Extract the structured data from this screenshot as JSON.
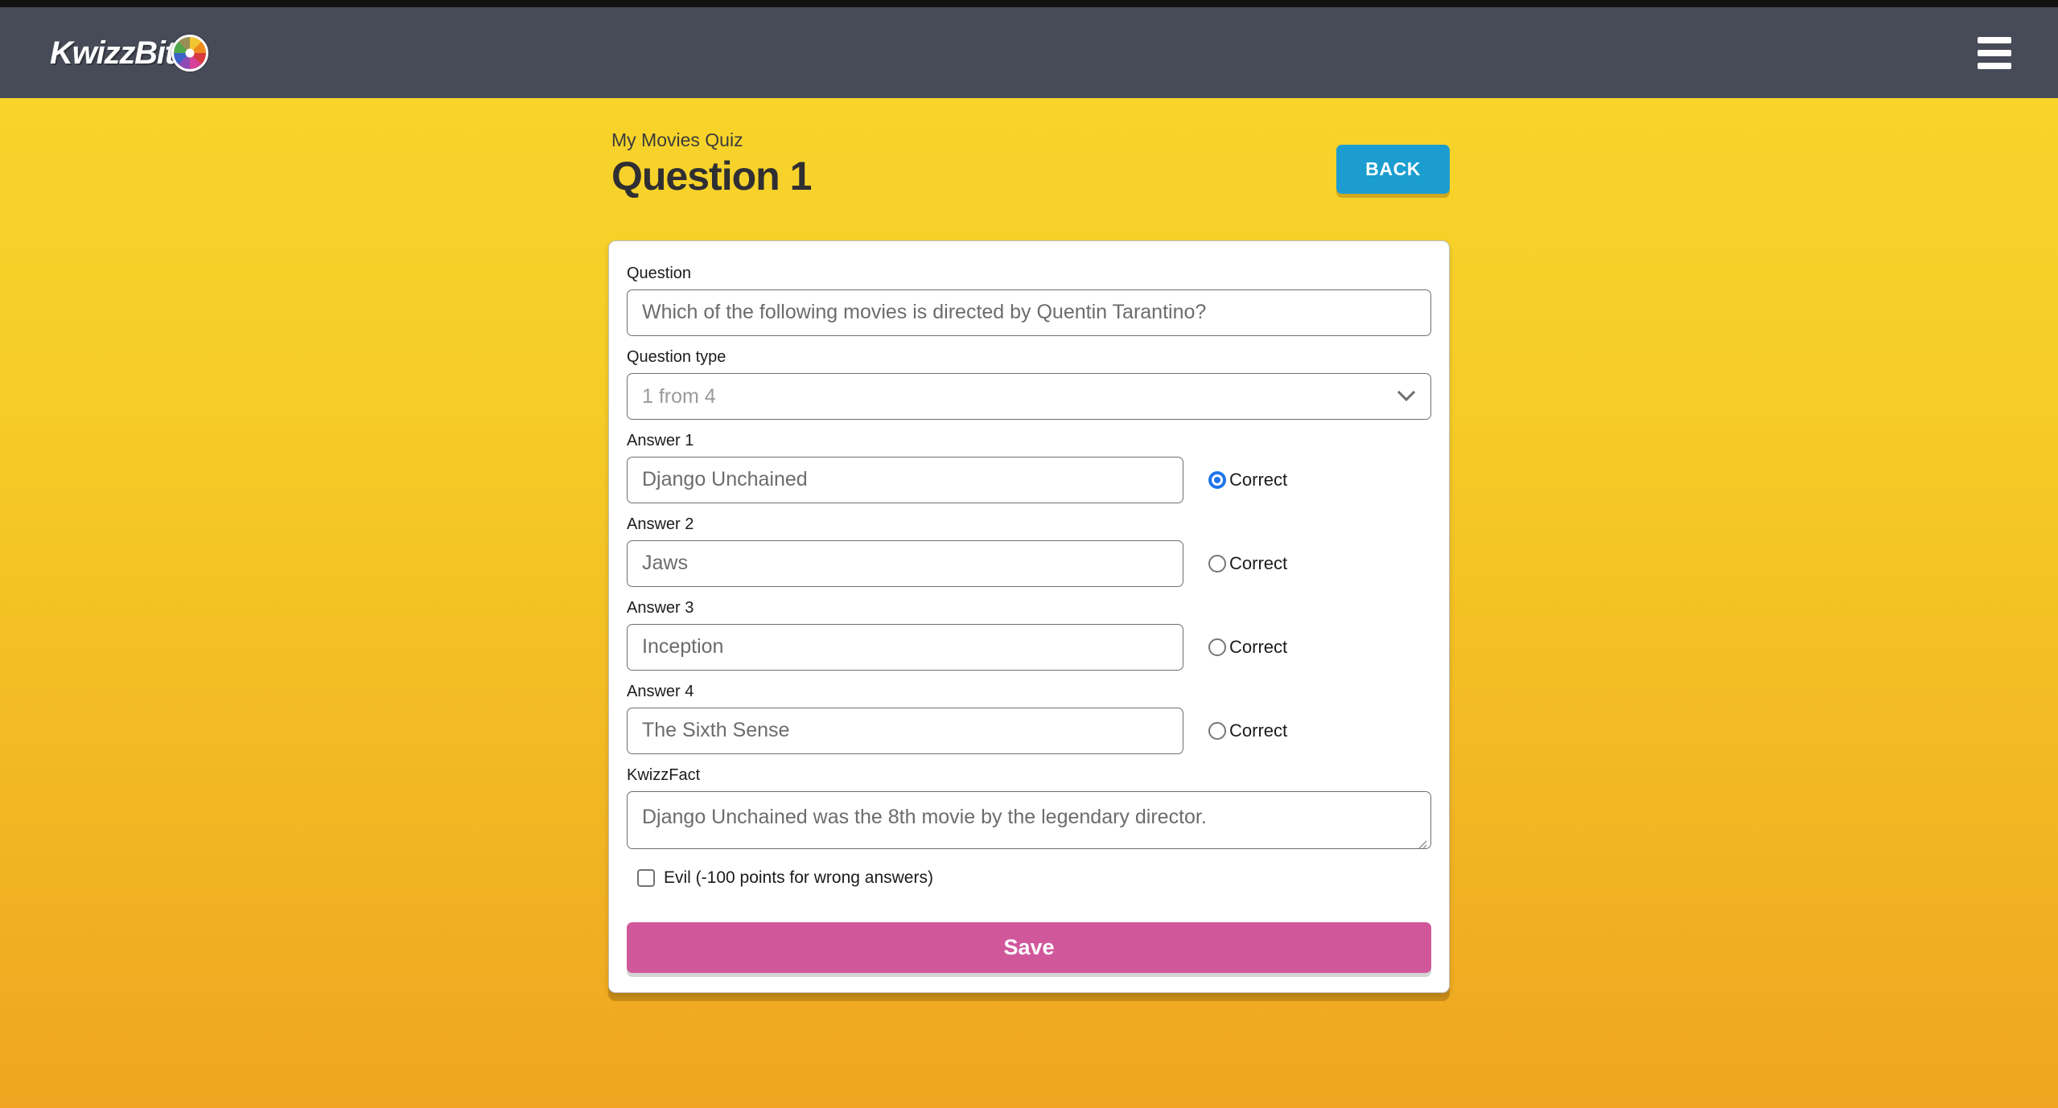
{
  "header": {
    "logo_text": "KwizzBit",
    "logo_icon": "quiz-wheel-icon",
    "menu_icon": "hamburger-menu-icon"
  },
  "page": {
    "breadcrumb": "My Movies Quiz",
    "title": "Question 1",
    "back_label": "BACK"
  },
  "form": {
    "question": {
      "label": "Question",
      "value": "Which of the following movies is directed by Quentin Tarantino?",
      "placeholder": "Question"
    },
    "question_type": {
      "label": "Question type",
      "value": "1 from 4",
      "options": [
        "1 from 4"
      ]
    },
    "answers": [
      {
        "label": "Answer 1",
        "value": "Django Unchained",
        "correct_label": "Correct",
        "correct": true
      },
      {
        "label": "Answer 2",
        "value": "Jaws",
        "correct_label": "Correct",
        "correct": false
      },
      {
        "label": "Answer 3",
        "value": "Inception",
        "correct_label": "Correct",
        "correct": false
      },
      {
        "label": "Answer 4",
        "value": "The Sixth Sense",
        "correct_label": "Correct",
        "correct": false
      }
    ],
    "kwizzfact": {
      "label": "KwizzFact",
      "value": "Django Unchained was the 8th movie by the legendary director."
    },
    "evil": {
      "label": "Evil (-100 points for wrong answers)",
      "checked": false
    },
    "save_label": "Save"
  },
  "colors": {
    "header_bg": "#474A57",
    "background_top": "#F8D62C",
    "background_bottom": "#EFA521",
    "back_button": "#1C9DD0",
    "save_button": "#D1579B",
    "radio_selected": "#1D76E9"
  }
}
